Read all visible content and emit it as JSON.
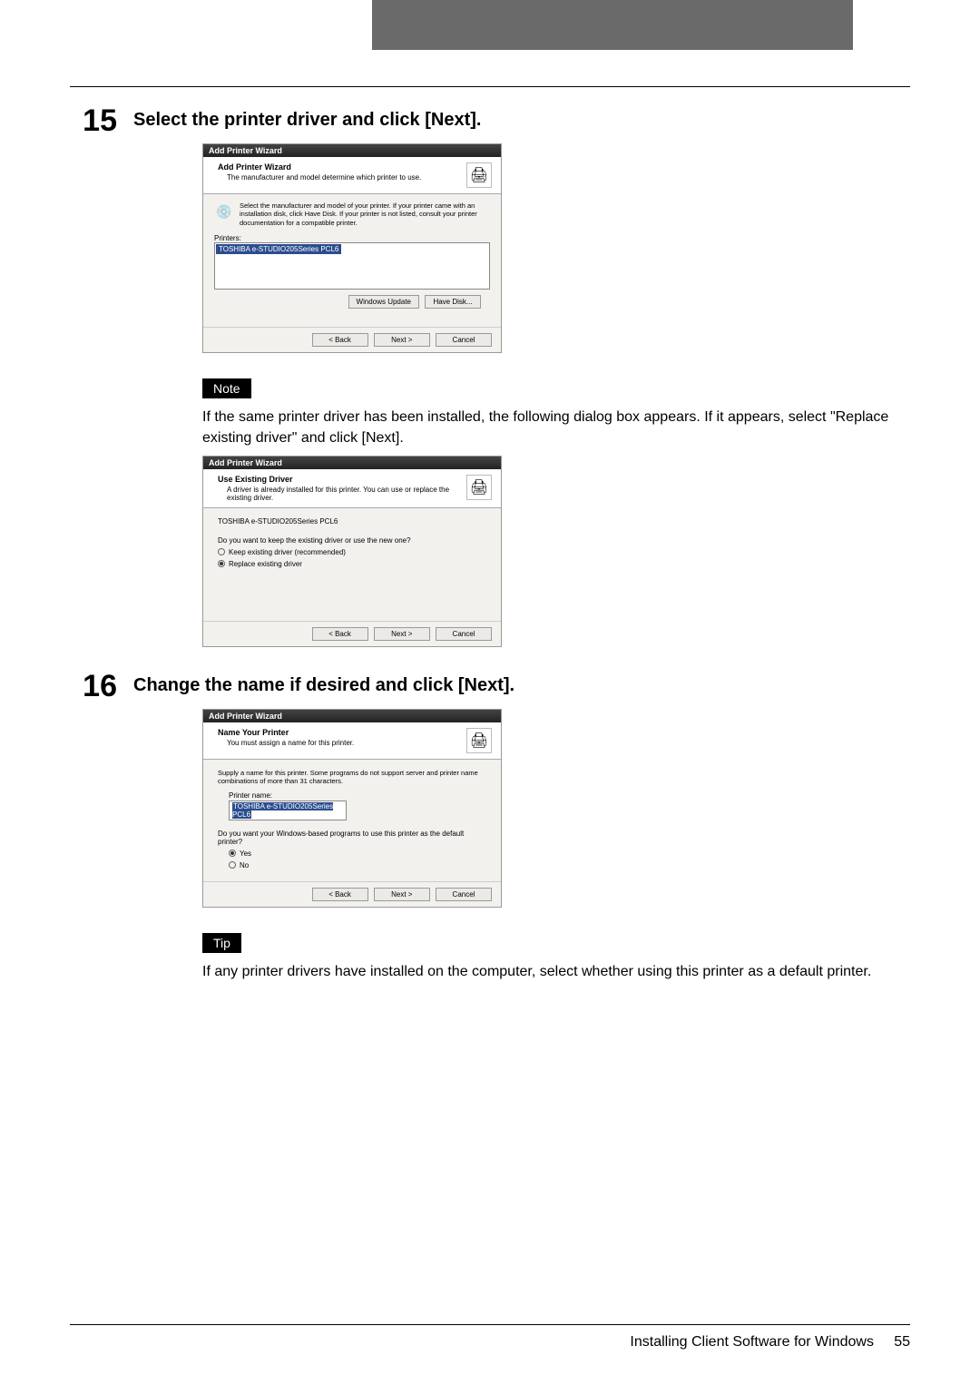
{
  "step15": {
    "num": "15",
    "title": "Select the printer driver and click [Next].",
    "wiz": {
      "window_title": "Add Printer Wizard",
      "head_h1": "Add Printer Wizard",
      "head_h2": "The manufacturer and model determine which printer to use.",
      "info": "Select the manufacturer and model of your printer. If your printer came with an installation disk, click Have Disk. If your printer is not listed, consult your printer documentation for a compatible printer.",
      "printers_label": "Printers:",
      "selected_printer": "TOSHIBA e-STUDIO205Series PCL6",
      "btn_winupdate": "Windows Update",
      "btn_havedisk": "Have Disk...",
      "btn_back": "< Back",
      "btn_next": "Next >",
      "btn_cancel": "Cancel"
    },
    "note_label": "Note",
    "note_text": "If the same printer driver has been installed, the following dialog box appears.  If it appears, select \"Replace existing driver\" and click [Next].",
    "wiz2": {
      "window_title": "Add Printer Wizard",
      "head_h1": "Use Existing Driver",
      "head_h2": "A driver is already installed for this printer. You can use or replace the existing driver.",
      "line1": "TOSHIBA e-STUDIO205Series PCL6",
      "q": "Do you want to keep the existing driver or use the new one?",
      "opt1": "Keep existing driver (recommended)",
      "opt2": "Replace existing driver",
      "btn_back": "< Back",
      "btn_next": "Next >",
      "btn_cancel": "Cancel"
    }
  },
  "step16": {
    "num": "16",
    "title": "Change the name if desired and click [Next].",
    "wiz": {
      "window_title": "Add Printer Wizard",
      "head_h1": "Name Your Printer",
      "head_h2": "You must assign a name for this printer.",
      "info": "Supply a name for this printer. Some programs do not support server and printer name combinations of more than 31 characters.",
      "name_label": "Printer name:",
      "name_value": "TOSHIBA e-STUDIO205Series PCL6",
      "q": "Do you want your Windows-based programs to use this printer as the default printer?",
      "opt_yes": "Yes",
      "opt_no": "No",
      "btn_back": "< Back",
      "btn_next": "Next >",
      "btn_cancel": "Cancel"
    },
    "tip_label": "Tip",
    "tip_text": "If any printer drivers have installed on the computer, select whether using this printer as a default printer."
  },
  "footer": {
    "text": "Installing Client Software for Windows",
    "page": "55"
  }
}
